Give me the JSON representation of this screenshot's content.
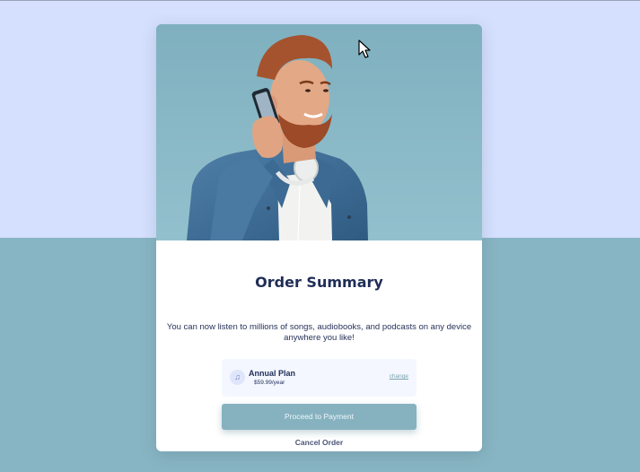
{
  "colors": {
    "top_band": "#d5e0fe",
    "bottom_band": "#88b5c3",
    "card": "#ffffff",
    "title": "#1f2d57",
    "button": "#86b2c0",
    "plan_bg": "#f4f7ff"
  },
  "hero": {
    "image": "man-on-phone-photo"
  },
  "order": {
    "title": "Order Summary",
    "description": "You can now listen to millions of songs, audiobooks, and podcasts on any device anywhere you like!"
  },
  "plan": {
    "icon": "music-note-icon",
    "name": "Annual Plan",
    "price": "$59.99/year",
    "change_label": "change"
  },
  "actions": {
    "proceed_label": "Proceed to Payment",
    "cancel_label": "Cancel Order"
  },
  "cursor": "arrow-cursor-icon"
}
